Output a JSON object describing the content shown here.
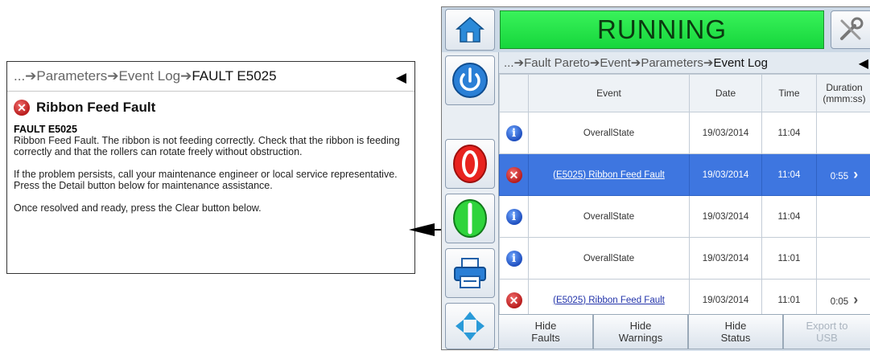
{
  "detail": {
    "breadcrumb": [
      "... ",
      "Parameters",
      "Event Log",
      "FAULT E5025"
    ],
    "back_glyph": "◀",
    "title": "Ribbon Feed Fault",
    "code": "FAULT E5025",
    "paragraphs": [
      "Ribbon Feed Fault. The ribbon is not feeding correctly. Check that the ribbon is feeding correctly and that the rollers can rotate freely without obstruction.",
      "If the problem persists, call your maintenance engineer or local service representative. Press the Detail button below for maintenance assistance.",
      "Once resolved and ready, press the Clear button below."
    ]
  },
  "header": {
    "status": "RUNNING",
    "status_color": "#22e046"
  },
  "screen": {
    "breadcrumb": [
      "... ",
      "Fault Pareto",
      "Event",
      "Parameters",
      "Event Log"
    ],
    "back_glyph": "◀"
  },
  "table": {
    "headers": [
      "",
      "Event",
      "Date",
      "Time",
      "Duration (mmm:ss)"
    ],
    "rows": [
      {
        "icon": "info-icon",
        "event": "OverallState",
        "link": false,
        "date": "19/03/2014",
        "time": "11:04",
        "duration": "",
        "chevron": false,
        "selected": false
      },
      {
        "icon": "fault-icon",
        "event": "(E5025) Ribbon Feed Fault",
        "link": true,
        "date": "19/03/2014",
        "time": "11:04",
        "duration": "0:55",
        "chevron": true,
        "selected": true
      },
      {
        "icon": "info-icon",
        "event": "OverallState",
        "link": false,
        "date": "19/03/2014",
        "time": "11:04",
        "duration": "",
        "chevron": false,
        "selected": false
      },
      {
        "icon": "info-icon",
        "event": "OverallState",
        "link": false,
        "date": "19/03/2014",
        "time": "11:01",
        "duration": "",
        "chevron": false,
        "selected": false
      },
      {
        "icon": "fault-icon",
        "event": "(E5025) Ribbon Feed Fault",
        "link": true,
        "date": "19/03/2014",
        "time": "11:01",
        "duration": "0:05",
        "chevron": true,
        "selected": false
      }
    ]
  },
  "bottom": {
    "buttons": [
      {
        "name": "hide-faults-button",
        "line1": "Hide",
        "line2": "Faults",
        "enabled": true
      },
      {
        "name": "hide-warnings-button",
        "line1": "Hide",
        "line2": "Warnings",
        "enabled": true
      },
      {
        "name": "hide-status-button",
        "line1": "Hide",
        "line2": "Status",
        "enabled": true
      },
      {
        "name": "export-usb-button",
        "line1": "Export to",
        "line2": "USB",
        "enabled": false
      }
    ]
  },
  "icons": {
    "home": "home-icon",
    "tools": "tools-icon",
    "power": "power-icon",
    "stop": "stop-icon",
    "start": "start-icon",
    "print": "printer-icon",
    "nav": "navigation-icon"
  }
}
